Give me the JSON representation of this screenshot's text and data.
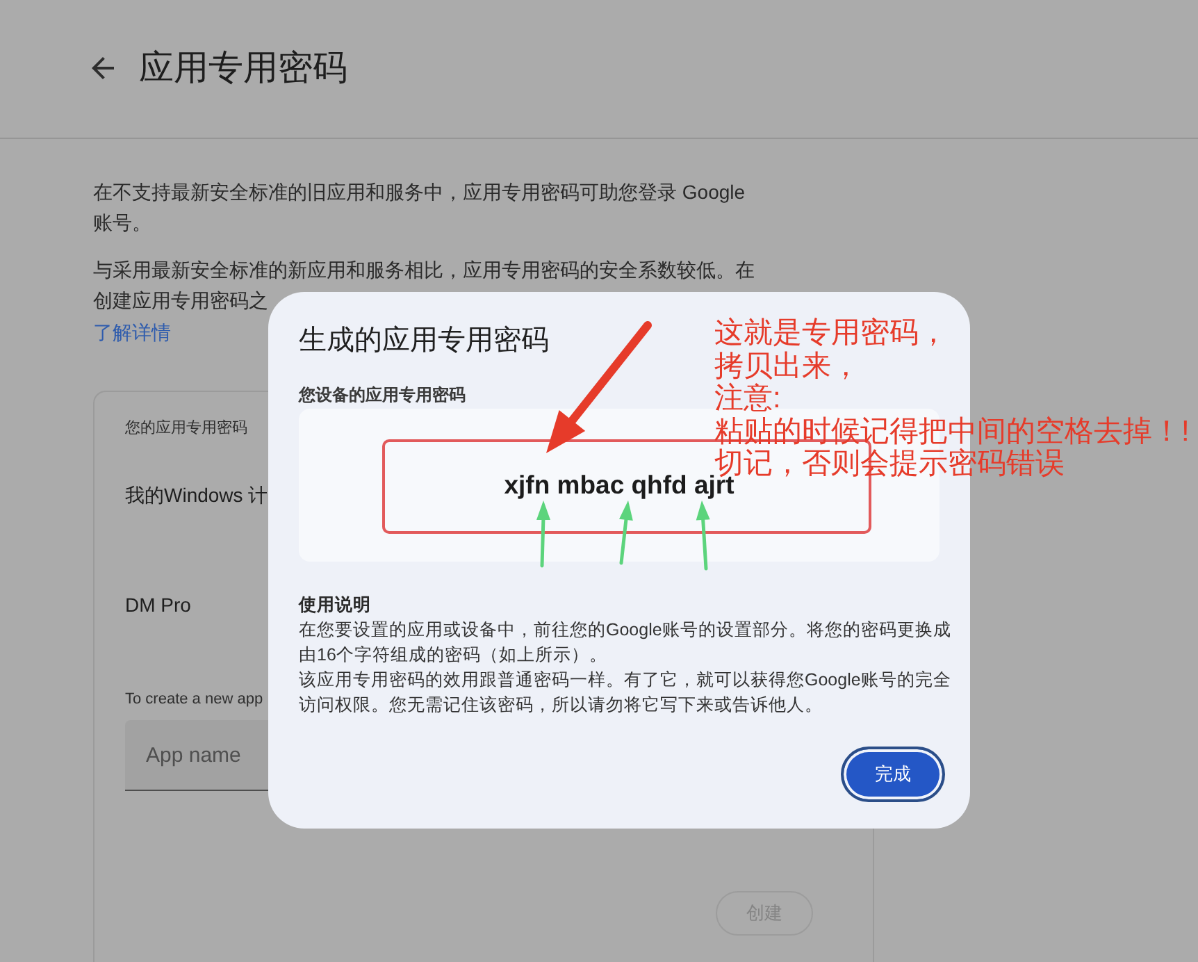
{
  "header": {
    "title": "应用专用密码"
  },
  "intro": [
    "在不支持最新安全标准的旧应用和服务中，应用专用密码可助您登录 Google 账号。",
    "与采用最新安全标准的新应用和服务相比，应用专用密码的安全系数较低。在创建应用专用密码之"
  ],
  "learn_more_link": "了解详情",
  "card": {
    "heading": "您的应用专用密码",
    "app_passwords": [
      "我的Windows 计",
      "DM Pro"
    ],
    "create_hint": "To create a new app",
    "app_name_field": {
      "placeholder": "App name"
    },
    "create_button": {
      "label": "创建",
      "disabled": true
    }
  },
  "dialog": {
    "title": "生成的应用专用密码",
    "password_label": "您设备的应用专用密码",
    "password": "xjfn mbac qhfd ajrt",
    "instructions_heading": "使用说明",
    "instructions": [
      "在您要设置的应用或设备中，前往您的Google账号的设置部分。将您的密码更换成由16个字符组成的密码（如上所示）。",
      "该应用专用密码的效用跟普通密码一样。有了它，就可以获得您Google账号的完全访问权限。您无需记住该密码，所以请勿将它写下来或告诉他人。"
    ],
    "done_button": "完成"
  },
  "annotation": {
    "lines": [
      "这就是专用密码，",
      "拷贝出来，",
      "注意:",
      "粘贴的时候记得把中间的空格去掉！!",
      "切记，否则会提示密码错误"
    ]
  }
}
